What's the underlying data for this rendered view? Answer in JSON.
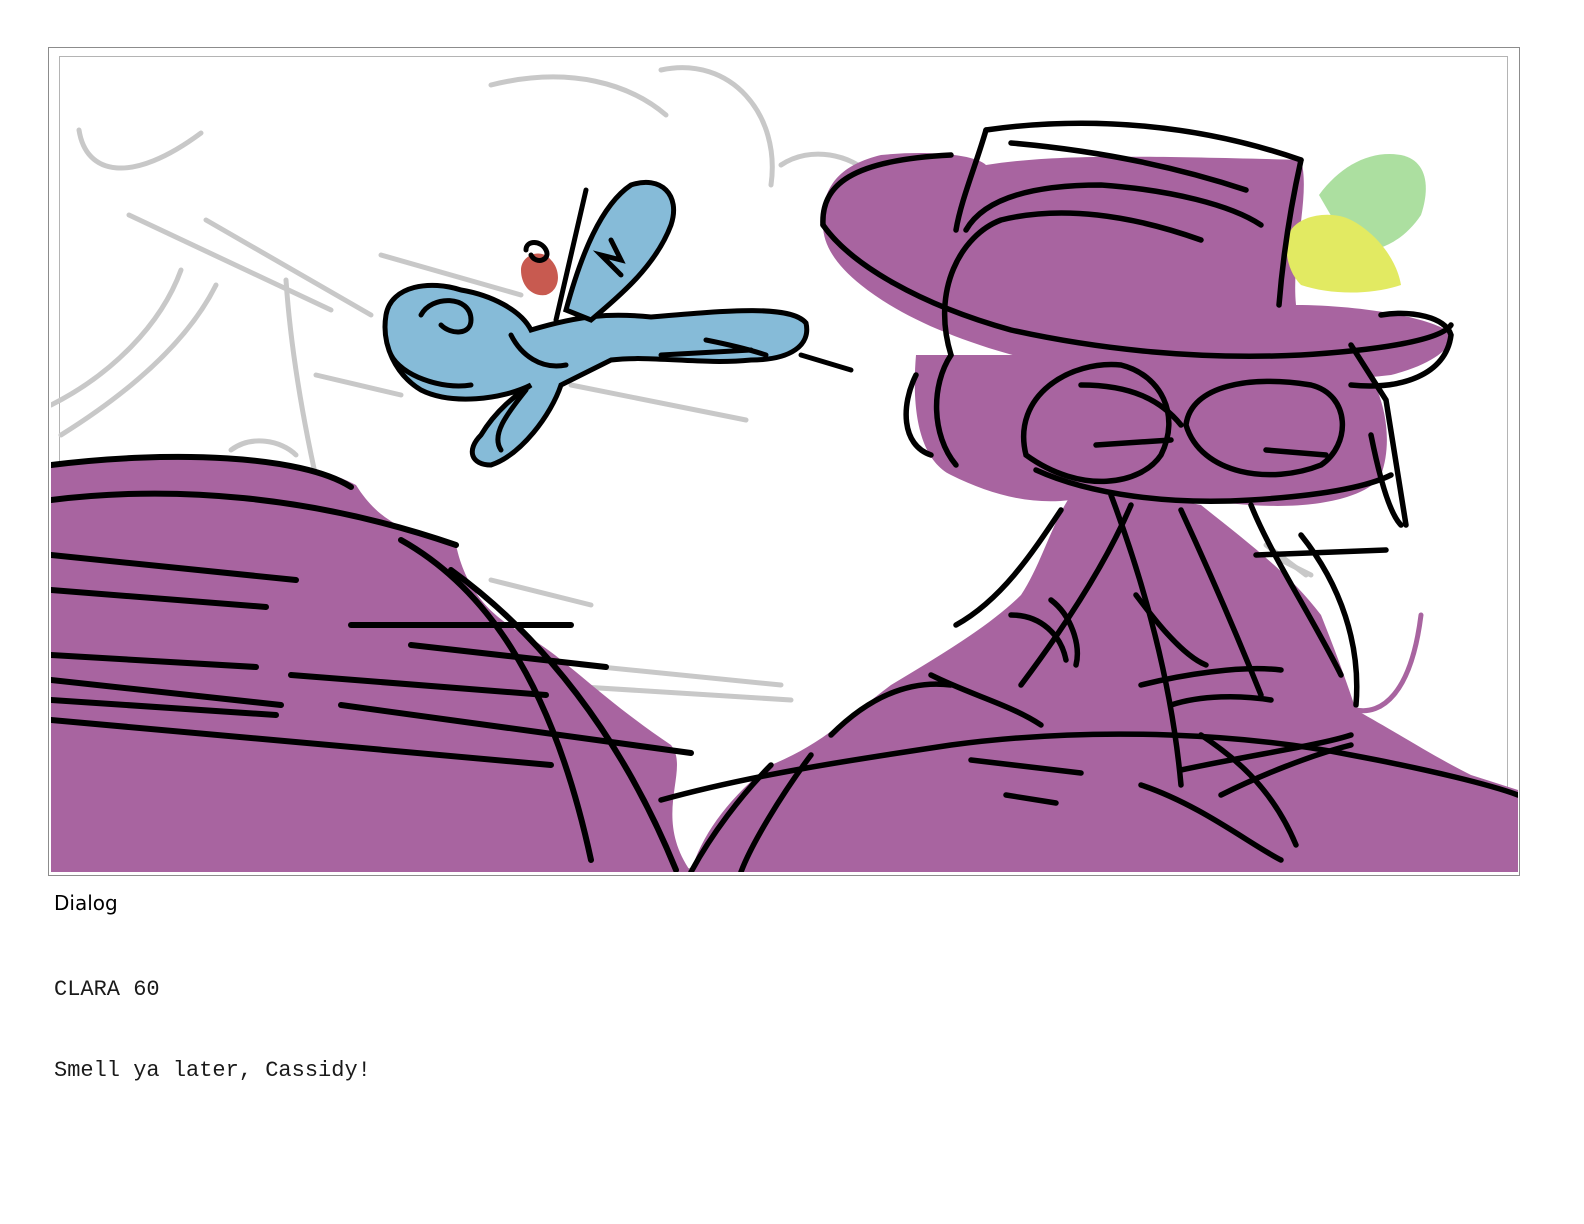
{
  "storyboard": {
    "panel": {
      "colors": {
        "fill_purple": "#a864a0",
        "fly_blue": "#86bbd8",
        "fly_red": "#c85a50",
        "feather_green": "#9ed98f",
        "feather_yellow": "#e2ea62",
        "sketch_gray": "#c8c8c8",
        "ink": "#000000"
      }
    },
    "dialog": {
      "label": "Dialog",
      "speaker": "CLARA 60",
      "line": "Smell ya later, Cassidy!"
    }
  }
}
